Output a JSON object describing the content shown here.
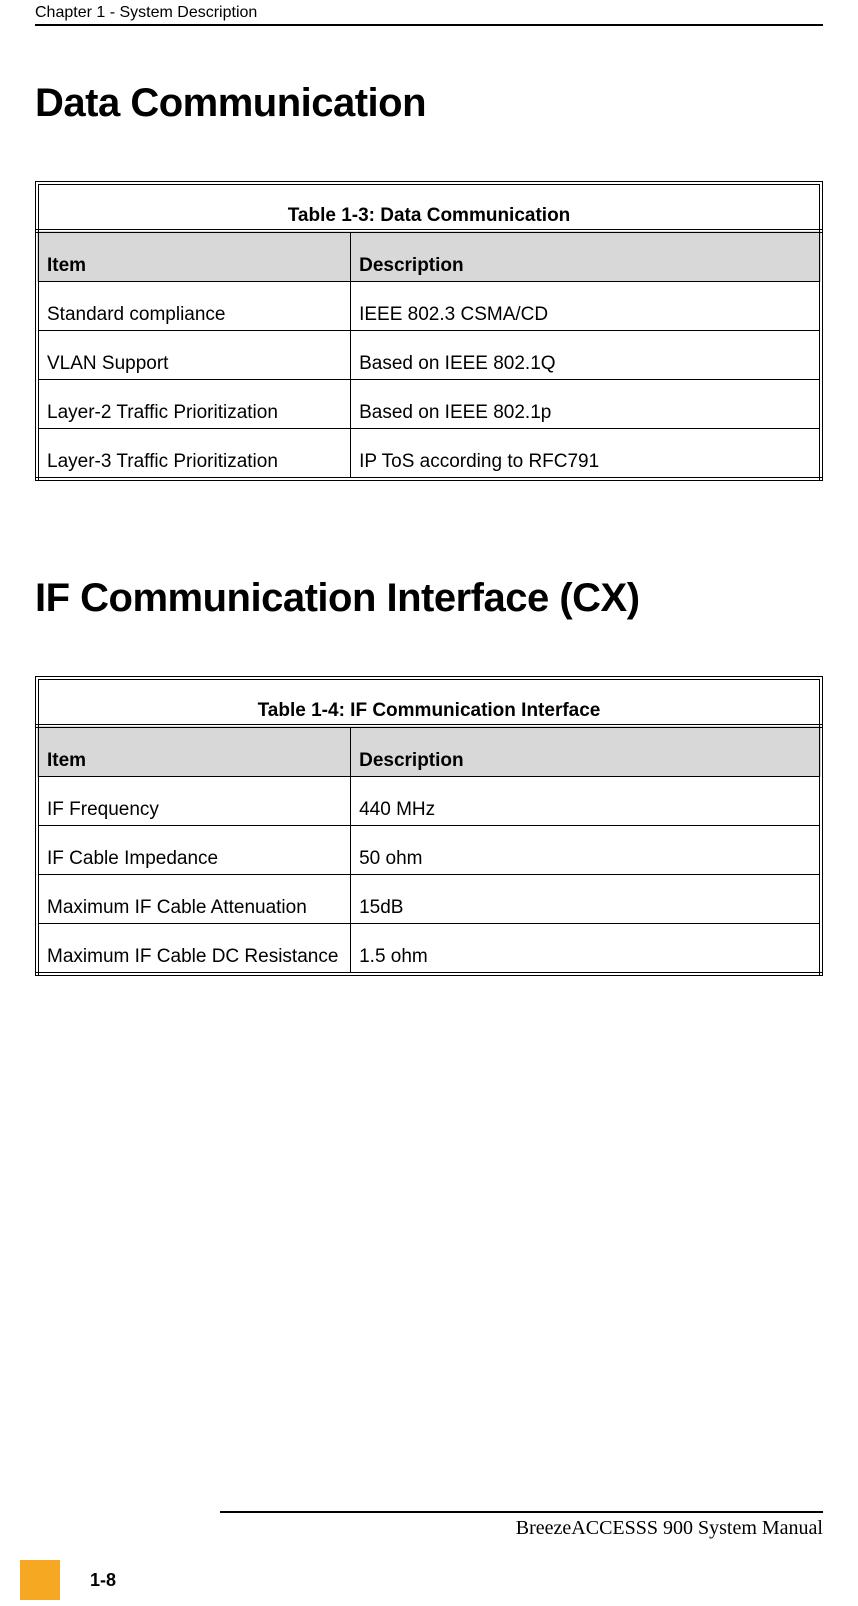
{
  "header": {
    "running": "Chapter 1 - System Description"
  },
  "sections": [
    {
      "title": "Data Communication",
      "table": {
        "caption": "Table 1-3: Data Communication",
        "columns": {
          "item": "Item",
          "description": "Description"
        },
        "rows": [
          {
            "item": "Standard compliance",
            "description": "IEEE 802.3 CSMA/CD"
          },
          {
            "item": "VLAN Support",
            "description": "Based on IEEE 802.1Q"
          },
          {
            "item": "Layer-2 Traffic Prioritization",
            "description": "Based on IEEE 802.1p"
          },
          {
            "item": "Layer-3 Traffic Prioritization",
            "description": "IP ToS according to RFC791"
          }
        ]
      }
    },
    {
      "title": "IF Communication Interface (CX)",
      "table": {
        "caption": "Table 1-4: IF Communication Interface",
        "columns": {
          "item": "Item",
          "description": "Description"
        },
        "rows": [
          {
            "item": "IF Frequency",
            "description": "440 MHz"
          },
          {
            "item": "IF Cable Impedance",
            "description": "50 ohm"
          },
          {
            "item": "Maximum IF Cable Attenuation",
            "description": "15dB"
          },
          {
            "item": "Maximum IF Cable DC Resistance",
            "description": "1.5 ohm"
          }
        ]
      }
    }
  ],
  "footer": {
    "title": "BreezeACCESSS 900 System Manual",
    "page": "1-8",
    "accent_color": "#f7a823"
  }
}
